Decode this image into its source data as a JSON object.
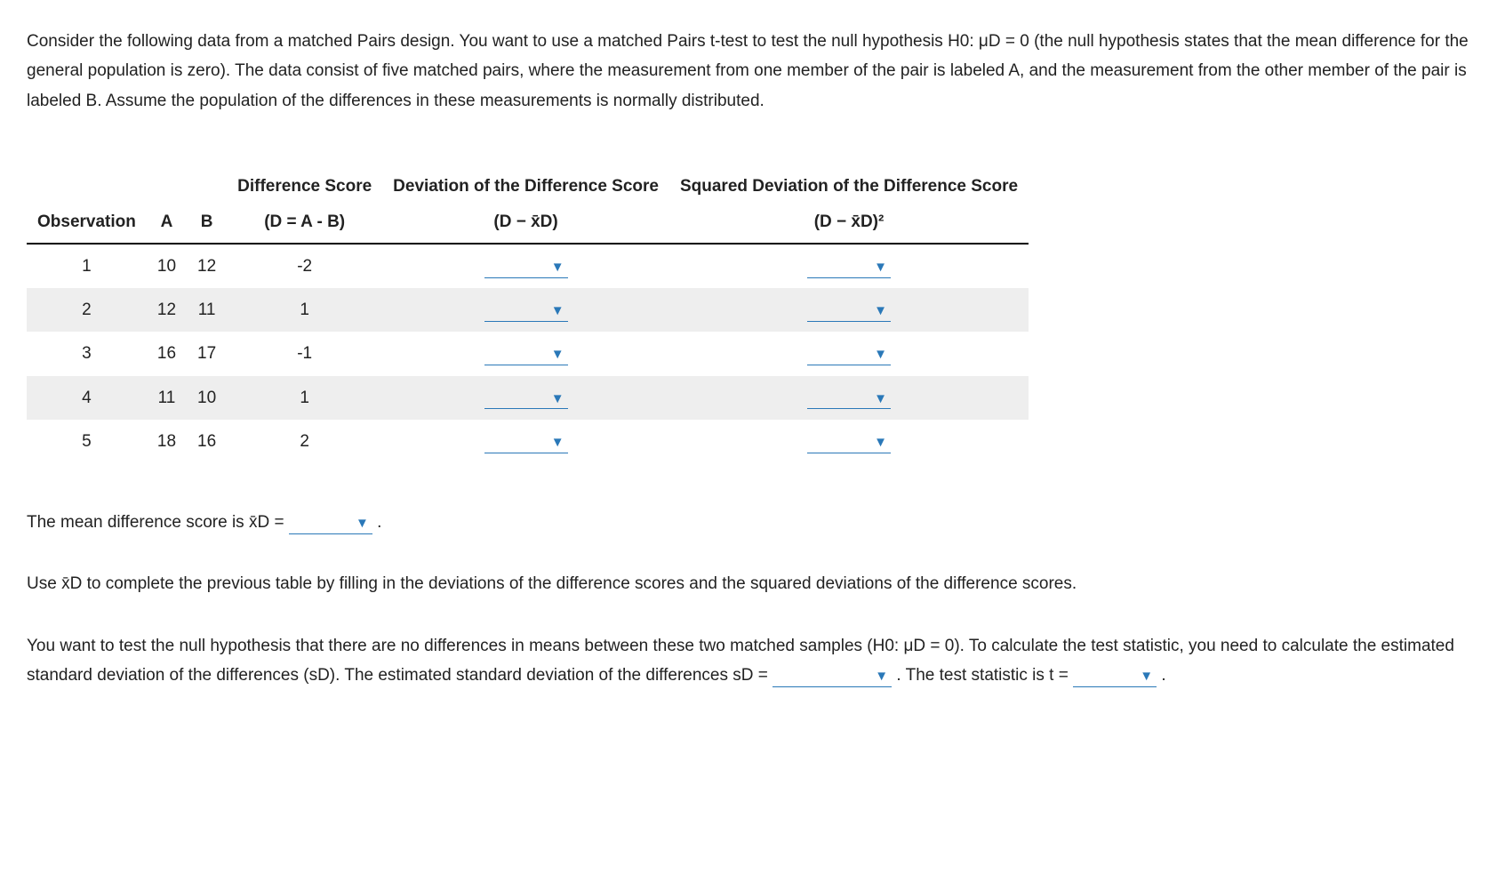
{
  "intro": "Consider the following data from a matched Pairs design. You want to use a matched Pairs t-test to test the null hypothesis H0: μD = 0 (the null hypothesis states that the mean difference for the general population is zero). The data consist of five matched pairs, where the measurement from one member of the pair is labeled A, and the measurement from the other member of the pair is labeled B. Assume the population of the differences in these measurements is normally distributed.",
  "table": {
    "headers": {
      "obs": "Observation",
      "a": "A",
      "b": "B",
      "diff_top": "Difference Score",
      "diff_sub": "(D = A - B)",
      "dev_top": "Deviation of the Difference Score",
      "dev_sub": "(D − x̄D)",
      "sq_top": "Squared Deviation of the Difference Score",
      "sq_sub": "(D − x̄D)²"
    },
    "rows": [
      {
        "obs": "1",
        "a": "10",
        "b": "12",
        "d": "-2"
      },
      {
        "obs": "2",
        "a": "12",
        "b": "11",
        "d": "1"
      },
      {
        "obs": "3",
        "a": "16",
        "b": "17",
        "d": "-1"
      },
      {
        "obs": "4",
        "a": "11",
        "b": "10",
        "d": "1"
      },
      {
        "obs": "5",
        "a": "18",
        "b": "16",
        "d": "2"
      }
    ]
  },
  "mean_line_pre": "The mean difference score is x̄D = ",
  "mean_line_post": " .",
  "instr2": "Use x̄D to complete the previous table by filling in the deviations of the difference scores and the squared deviations of the difference scores.",
  "instr3_pre": "You want to test the null hypothesis that there are no differences in means between these two matched samples (H0: μD = 0). To calculate the test statistic, you need to calculate the estimated standard deviation of the differences (sD). The estimated standard deviation of the differences sD = ",
  "instr3_mid": " . The test statistic is t = ",
  "instr3_post": " ."
}
